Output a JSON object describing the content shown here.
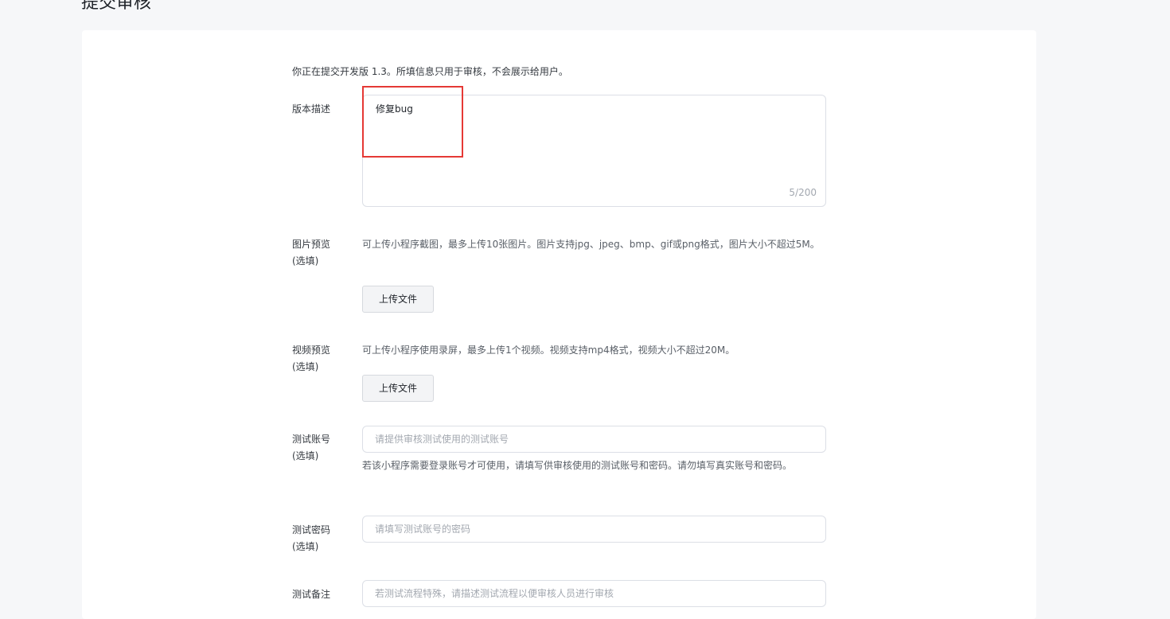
{
  "page_title": "提交审核",
  "intro_text": "你正在提交开发版 1.3。所填信息只用于审核，不会展示给用户。",
  "version_desc": {
    "label": "版本描述",
    "value": "修复bug",
    "counter": "5/200"
  },
  "image_preview": {
    "label_line1": "图片预览",
    "label_line2": "(选填)",
    "desc": "可上传小程序截图，最多上传10张图片。图片支持jpg、jpeg、bmp、gif或png格式，图片大小不超过5M。",
    "upload_label": "上传文件"
  },
  "video_preview": {
    "label_line1": "视频预览",
    "label_line2": "(选填)",
    "desc": "可上传小程序使用录屏，最多上传1个视频。视频支持mp4格式，视频大小不超过20M。",
    "upload_label": "上传文件"
  },
  "test_account": {
    "label_line1": "测试账号",
    "label_line2": "(选填)",
    "placeholder": "请提供审核测试使用的测试账号",
    "hint": "若该小程序需要登录账号才可使用，请填写供审核使用的测试账号和密码。请勿填写真实账号和密码。"
  },
  "test_password": {
    "label_line1": "测试密码",
    "label_line2": "(选填)",
    "placeholder": "请填写测试账号的密码"
  },
  "test_notes": {
    "label": "测试备注",
    "placeholder": "若测试流程特殊，请描述测试流程以便审核人员进行审核"
  },
  "colors": {
    "highlight": "#e53935",
    "background": "#f6f7f9",
    "panel": "#ffffff"
  }
}
